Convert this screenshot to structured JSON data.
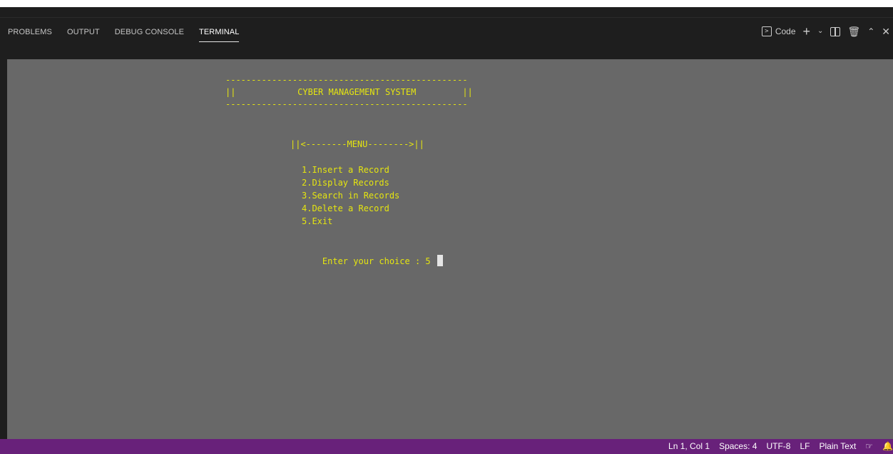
{
  "tabs": [
    {
      "label": "PROBLEMS"
    },
    {
      "label": "OUTPUT"
    },
    {
      "label": "DEBUG CONSOLE"
    },
    {
      "label": "TERMINAL"
    }
  ],
  "active_tab": "TERMINAL",
  "header_actions": {
    "terminal_profile": "Code"
  },
  "terminal": {
    "lines": {
      "rule_top": "-----------------------------------------------",
      "title_line": "||            CYBER MANAGEMENT SYSTEM         ||",
      "rule_bottom": "-----------------------------------------------",
      "menu_header": "||<--------MENU-------->||",
      "option_1": "1.Insert a Record",
      "option_2": "2.Display Records",
      "option_3": "3.Search in Records",
      "option_4": "4.Delete a Record",
      "option_5": "5.Exit",
      "prompt": "Enter your choice : 5 "
    }
  },
  "status_bar": {
    "position": "Ln 1, Col 1",
    "spaces": "Spaces: 4",
    "encoding": "UTF-8",
    "eol": "LF",
    "language": "Plain Text"
  },
  "colors": {
    "terminal_bg": "#686868",
    "terminal_text": "#e5e510",
    "status_bar": "#68217a",
    "panel_bg": "#1e1e1e"
  }
}
